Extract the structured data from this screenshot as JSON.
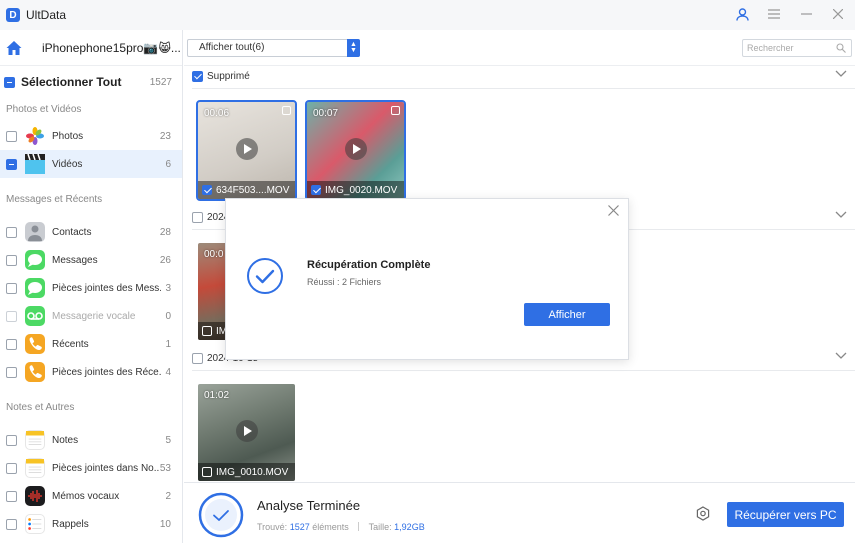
{
  "app": {
    "title": "UltData"
  },
  "sidebar": {
    "device_name": "iPhonephone15pro📷😸...",
    "select_all": {
      "label": "Sélectionner Tout",
      "count": "1527"
    },
    "sections": [
      {
        "title": "Photos et Vidéos",
        "items": [
          {
            "label": "Photos",
            "count": "23",
            "icon": "photos-icon"
          },
          {
            "label": "Vidéos",
            "count": "6",
            "icon": "videos-icon"
          }
        ]
      },
      {
        "title": "Messages et Récents",
        "items": [
          {
            "label": "Contacts",
            "count": "28",
            "icon": "contacts-icon"
          },
          {
            "label": "Messages",
            "count": "26",
            "icon": "messages-icon"
          },
          {
            "label": "Pièces jointes des Mess...",
            "count": "3",
            "icon": "message-attachments-icon"
          },
          {
            "label": "Messagerie vocale",
            "count": "0",
            "icon": "voicemail-icon"
          },
          {
            "label": "Récents",
            "count": "1",
            "icon": "phone-icon"
          },
          {
            "label": "Pièces jointes des Réce...",
            "count": "4",
            "icon": "phone-attachments-icon"
          }
        ]
      },
      {
        "title": "Notes et Autres",
        "items": [
          {
            "label": "Notes",
            "count": "5",
            "icon": "notes-icon"
          },
          {
            "label": "Pièces jointes dans No...",
            "count": "53",
            "icon": "notes-attachments-icon"
          },
          {
            "label": "Mémos vocaux",
            "count": "2",
            "icon": "voice-memos-icon"
          },
          {
            "label": "Rappels",
            "count": "10",
            "icon": "reminders-icon"
          }
        ]
      }
    ]
  },
  "toolbar": {
    "filter_value": "Afficher tout(6)",
    "search_placeholder": "Rechercher"
  },
  "groups": [
    {
      "label": "Supprimé",
      "thumbs": [
        {
          "duration": "00:06",
          "name": "634F503....MOV"
        },
        {
          "duration": "00:07",
          "name": "IMG_0020.MOV"
        }
      ]
    },
    {
      "label": "2024",
      "thumbs": [
        {
          "duration": "00:0",
          "name": "IM"
        }
      ]
    },
    {
      "label": "2024-10-15",
      "thumbs": [
        {
          "duration": "01:02",
          "name": "IMG_0010.MOV"
        }
      ]
    }
  ],
  "dialog": {
    "title": "Récupération Complète",
    "subtitle": "Réussi : 2 Fichiers",
    "button": "Afficher"
  },
  "bottom": {
    "title": "Analyse Terminée",
    "found_label": "Trouvé:",
    "found_value": "1527",
    "found_unit": "éléments",
    "size_label": "Taille:",
    "size_value": "1,92GB",
    "recover_button": "Récupérer vers PC"
  },
  "colors": {
    "accent": "#2f6fe4"
  }
}
